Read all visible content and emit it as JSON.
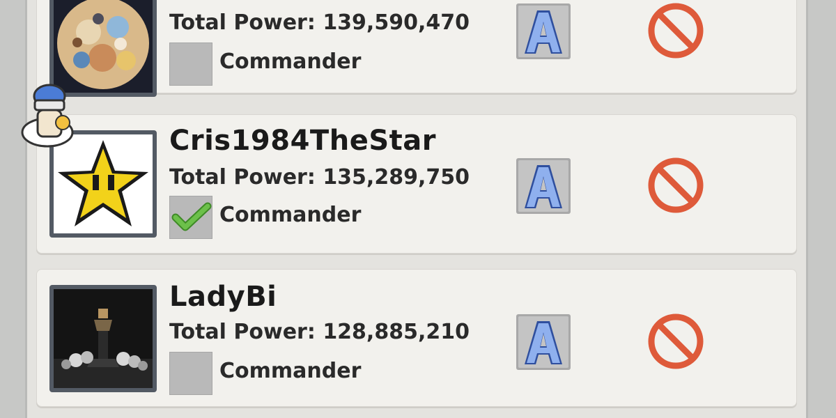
{
  "members": [
    {
      "name": "",
      "power_label": "Total Power:",
      "power_value": "139,590,470",
      "commander_label": "Commander",
      "commander_checked": false,
      "rank_letter": "A",
      "avatar": "anime-collage-avatar"
    },
    {
      "name": "Cris1984TheStar",
      "power_label": "Total Power:",
      "power_value": "135,289,750",
      "commander_label": "Commander",
      "commander_checked": true,
      "rank_letter": "A",
      "avatar": "pixel-star-avatar"
    },
    {
      "name": "LadyBi",
      "power_label": "Total Power:",
      "power_value": "128,885,210",
      "commander_label": "Commander",
      "commander_checked": false,
      "rank_letter": "A",
      "avatar": "chess-king-avatar"
    }
  ],
  "colors": {
    "kick": "#de5a3a",
    "rank_blue": "#6b8fd8",
    "check_green": "#6cc04a"
  },
  "icons": {
    "rank_badge": "letter-a-badge-icon",
    "kick": "prohibited-icon",
    "leader": "leader-character-icon",
    "checkmark": "checkmark-icon"
  }
}
